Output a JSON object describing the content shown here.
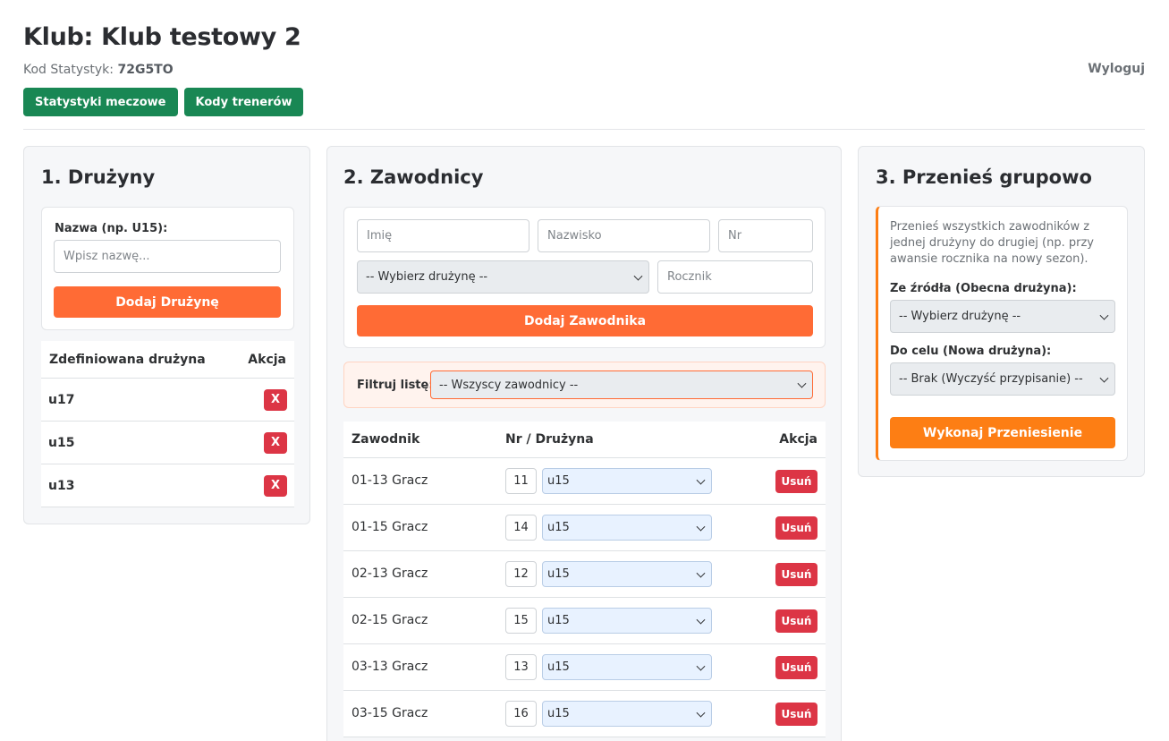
{
  "header": {
    "title": "Klub: Klub testowy 2",
    "stat_code_label": "Kod Statystyk:",
    "stat_code_value": "72G5TO",
    "logout": "Wyloguj",
    "nav": [
      "Statystyki meczowe",
      "Kody trenerów"
    ]
  },
  "teams_panel": {
    "title": "1. Drużyny",
    "name_label": "Nazwa (np. U15):",
    "name_placeholder": "Wpisz nazwę...",
    "add_button": "Dodaj Drużynę",
    "col_team": "Zdefiniowana drużyna",
    "col_action": "Akcja",
    "delete_label": "X",
    "teams": [
      "u17",
      "u15",
      "u13"
    ]
  },
  "players_panel": {
    "title": "2. Zawodnicy",
    "first_name_placeholder": "Imię",
    "last_name_placeholder": "Nazwisko",
    "number_placeholder": "Nr",
    "team_select": "-- Wybierz drużynę --",
    "year_placeholder": "Rocznik",
    "add_button": "Dodaj Zawodnika",
    "filter_label": "Filtruj listę:",
    "filter_value": "-- Wszyscy zawodnicy --",
    "col_player": "Zawodnik",
    "col_nr_team": "Nr / Drużyna",
    "col_action": "Akcja",
    "delete_label": "Usuń",
    "players": [
      {
        "name": "01-13 Gracz",
        "nr": "11",
        "team": "u15"
      },
      {
        "name": "01-15 Gracz",
        "nr": "14",
        "team": "u15"
      },
      {
        "name": "02-13 Gracz",
        "nr": "12",
        "team": "u15"
      },
      {
        "name": "02-15 Gracz",
        "nr": "15",
        "team": "u15"
      },
      {
        "name": "03-13 Gracz",
        "nr": "13",
        "team": "u15"
      },
      {
        "name": "03-15 Gracz",
        "nr": "16",
        "team": "u15"
      }
    ]
  },
  "transfer_panel": {
    "title": "3. Przenieś grupowo",
    "description": "Przenieś wszystkich zawodników z jednej drużyny do drugiej (np. przy awansie rocznika na nowy sezon).",
    "source_label": "Ze źródła (Obecna drużyna):",
    "source_value": "-- Wybierz drużynę --",
    "target_label": "Do celu (Nowa drużyna):",
    "target_value": "-- Brak (Wyczyść przypisanie) --",
    "execute_button": "Wykonaj Przeniesienie"
  }
}
